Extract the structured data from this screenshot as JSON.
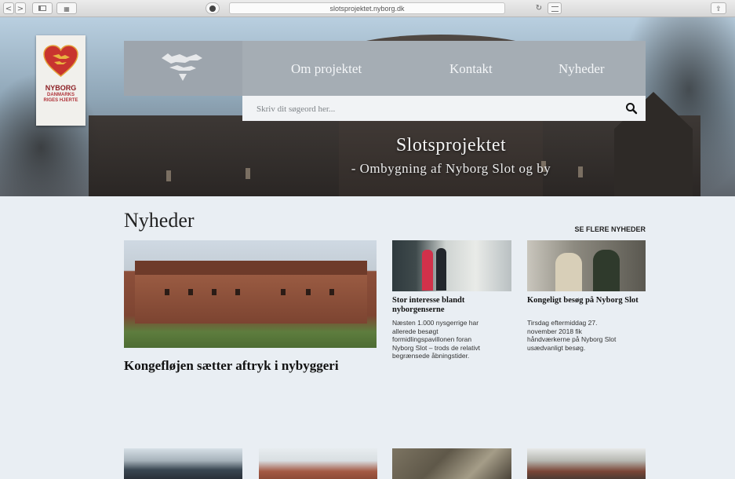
{
  "browser": {
    "url": "slotsprojektet.nyborg.dk",
    "back_glyph": "<",
    "forward_glyph": ">",
    "sidebar_icon": "sidebar-icon",
    "grid_icon": "grid-icon",
    "reload_glyph": "↻",
    "share_icon": "share-icon"
  },
  "logo": {
    "line1": "NYBORG",
    "line2": "DANMARKS",
    "line3": "RIGES HJERTE"
  },
  "nav": {
    "items": [
      {
        "label": "Om projektet"
      },
      {
        "label": "Kontakt"
      },
      {
        "label": "Nyheder"
      }
    ]
  },
  "search": {
    "placeholder": "Skriv dit søgeord her...",
    "icon": "search-icon"
  },
  "hero": {
    "title": "Slotsprojektet",
    "subtitle": "- Ombygning af Nyborg Slot og by"
  },
  "news": {
    "heading": "Nyheder",
    "see_more": "SE FLERE NYHEDER",
    "featured": {
      "title": "Kongefløjen sætter aftryk i nybyggeri"
    },
    "items": [
      {
        "title": "Stor interesse blandt nyborgenserne",
        "text": "Næsten 1.000 nysgerrige har allerede besøgt formidlingspavillonen foran Nyborg Slot – trods de relativt begrænsede åbningstider."
      },
      {
        "title": "Kongeligt besøg på Nyborg Slot",
        "text": "Tirsdag eftermiddag 27. november 2018 fik håndværkerne på Nyborg Slot usædvanligt besøg."
      }
    ]
  },
  "colors": {
    "nav_bg": "#a5adb4",
    "emblem_bg": "#9da5ad",
    "page_bg": "#e9eef3",
    "logo_red": "#c8342f"
  }
}
